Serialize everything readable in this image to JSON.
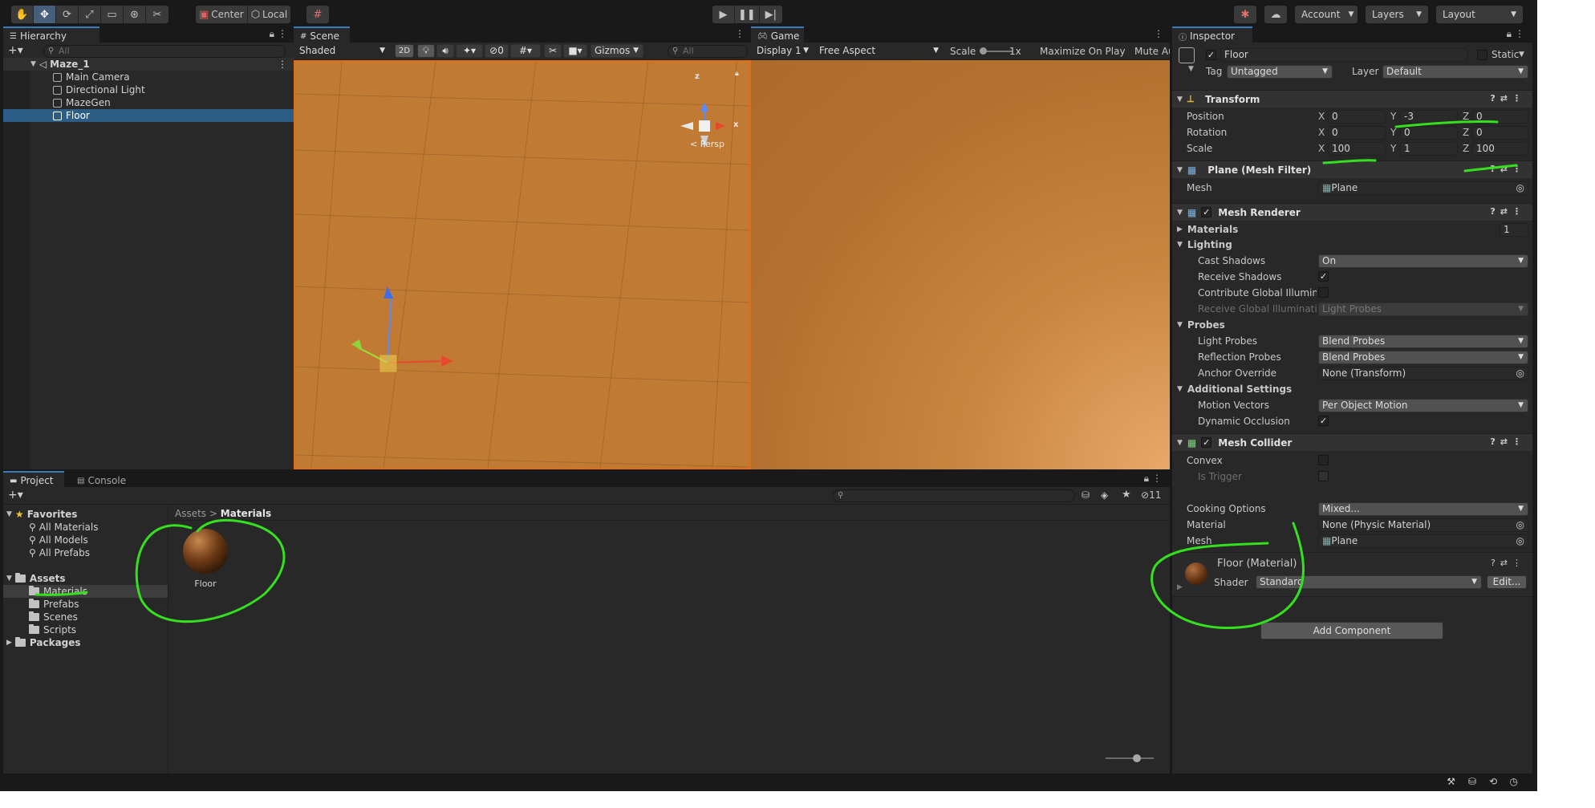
{
  "toolbar": {
    "pivot_center_label": "Center",
    "pivot_local_label": "Local",
    "account_label": "Account",
    "layers_label": "Layers",
    "layout_label": "Layout"
  },
  "hierarchy": {
    "tab_label": "Hierarchy",
    "search_placeholder": "All",
    "scene_name": "Maze_1",
    "items": [
      "Main Camera",
      "Directional Light",
      "MazeGen",
      "Floor"
    ]
  },
  "scene": {
    "tab_label": "Scene",
    "shading_mode": "Shaded",
    "mode_2d_label": "2D",
    "hidden_count": "0",
    "gizmos_label": "Gizmos",
    "search_placeholder": "All",
    "persp_label": "< Persp",
    "gizmo_axes": {
      "x": "x",
      "z": "z"
    }
  },
  "game": {
    "tab_label": "Game",
    "display_label": "Display 1",
    "aspect_label": "Free Aspect",
    "scale_label": "Scale",
    "scale_value": "1x",
    "maximize_label": "Maximize On Play",
    "mute_label": "Mute Au"
  },
  "inspector": {
    "tab_label": "Inspector",
    "object_name": "Floor",
    "static_label": "Static",
    "tag_label": "Tag",
    "tag_value": "Untagged",
    "layer_label": "Layer",
    "layer_value": "Default",
    "transform": {
      "title": "Transform",
      "position_label": "Position",
      "rotation_label": "Rotation",
      "scale_label": "Scale",
      "position": {
        "x": "0",
        "y": "-3",
        "z": "0"
      },
      "rotation": {
        "x": "0",
        "y": "0",
        "z": "0"
      },
      "scale": {
        "x": "100",
        "y": "1",
        "z": "100"
      }
    },
    "mesh_filter": {
      "title": "Plane (Mesh Filter)",
      "mesh_label": "Mesh",
      "mesh_value": "Plane"
    },
    "mesh_renderer": {
      "title": "Mesh Renderer",
      "materials_label": "Materials",
      "materials_count": "1",
      "lighting_label": "Lighting",
      "cast_shadows_label": "Cast Shadows",
      "cast_shadows_value": "On",
      "receive_shadows_label": "Receive Shadows",
      "contribute_gi_label": "Contribute Global Illuminat",
      "receive_gi_label": "Receive Global Illuminatio",
      "receive_gi_value": "Light Probes",
      "probes_label": "Probes",
      "light_probes_label": "Light Probes",
      "light_probes_value": "Blend Probes",
      "reflection_probes_label": "Reflection Probes",
      "reflection_probes_value": "Blend Probes",
      "anchor_override_label": "Anchor Override",
      "anchor_override_value": "None (Transform)",
      "additional_label": "Additional Settings",
      "motion_vectors_label": "Motion Vectors",
      "motion_vectors_value": "Per Object Motion",
      "dynamic_occlusion_label": "Dynamic Occlusion"
    },
    "mesh_collider": {
      "title": "Mesh Collider",
      "convex_label": "Convex",
      "is_trigger_label": "Is Trigger",
      "cooking_label": "Cooking Options",
      "cooking_value": "Mixed...",
      "material_label": "Material",
      "material_value": "None (Physic Material)",
      "mesh_label": "Mesh",
      "mesh_value": "Plane"
    },
    "material": {
      "title": "Floor (Material)",
      "shader_label": "Shader",
      "shader_value": "Standard",
      "edit_label": "Edit..."
    },
    "add_component_label": "Add Component"
  },
  "project": {
    "tab_label": "Project",
    "console_tab_label": "Console",
    "favorites_label": "Favorites",
    "favorites": [
      "All Materials",
      "All Models",
      "All Prefabs"
    ],
    "assets_label": "Assets",
    "asset_folders": [
      "Materials",
      "Prefabs",
      "Scenes",
      "Scripts"
    ],
    "packages_label": "Packages",
    "breadcrumb_root": "Assets",
    "breadcrumb_sep": ">",
    "breadcrumb_current": "Materials",
    "hidden_count": "11",
    "asset_items": [
      "Floor"
    ]
  },
  "colors": {
    "accent_selection": "#2c5d87",
    "scene_orange": "#c17a33",
    "annotation_green": "#35e01f"
  }
}
